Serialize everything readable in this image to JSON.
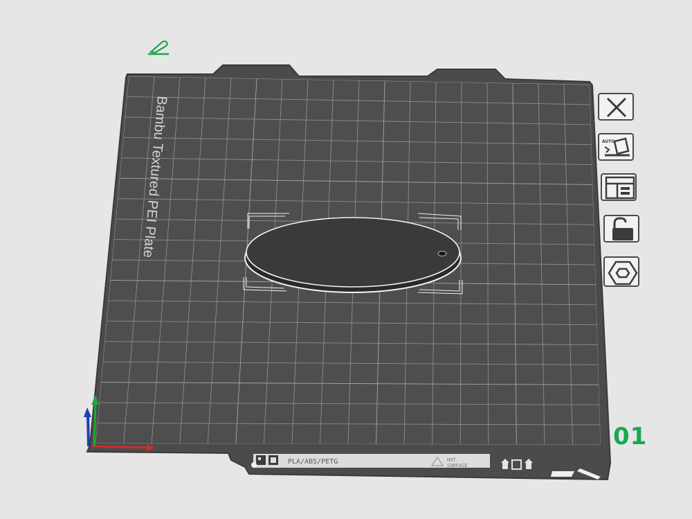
{
  "plate": {
    "name": "Bambu Textured PEI Plate",
    "materials": "PLA/ABS/PETG",
    "hot_surface_line1": "HOT",
    "hot_surface_line2": "SURFACE",
    "number": "01"
  },
  "toolbar": {
    "auto_label": "AUTO",
    "buttons": [
      {
        "name": "close-plate-button",
        "icon": "close-icon"
      },
      {
        "name": "auto-orient-button",
        "icon": "auto-orient-icon"
      },
      {
        "name": "arrange-button",
        "icon": "arrange-icon"
      },
      {
        "name": "lock-plate-button",
        "icon": "unlock-icon"
      },
      {
        "name": "plate-settings-button",
        "icon": "hexagon-settings-icon"
      }
    ]
  },
  "colors": {
    "background": "#e6e6e6",
    "plate": "#4a4a4a",
    "grid": "#8a8a8a",
    "accent_green": "#19a84e",
    "axis_x": "#d42a2a",
    "axis_y": "#1fa83a",
    "axis_z": "#1a3fb8"
  }
}
